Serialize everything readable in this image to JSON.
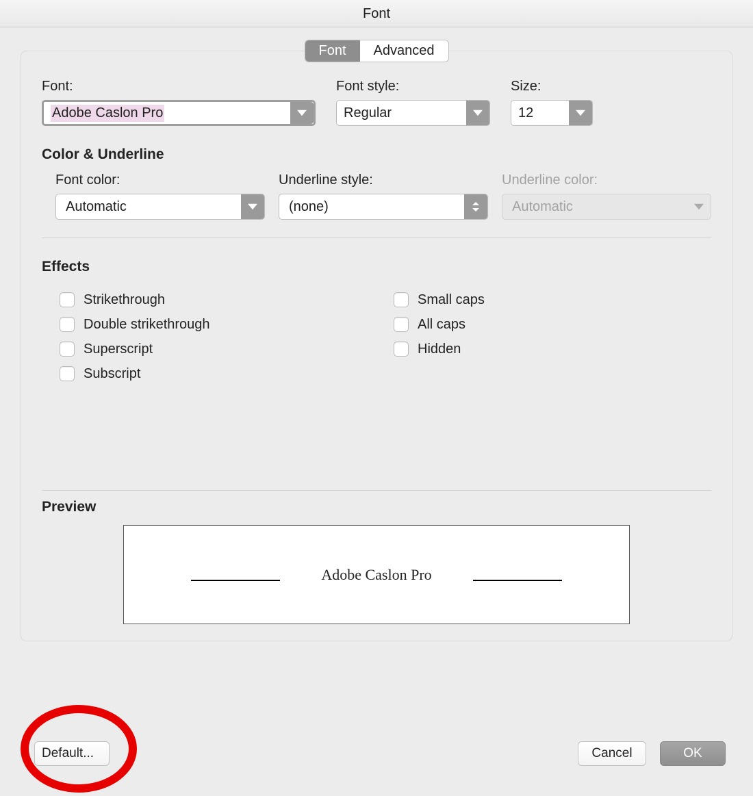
{
  "window": {
    "title": "Font"
  },
  "tabs": {
    "font": "Font",
    "advanced": "Advanced"
  },
  "fields": {
    "font_label": "Font:",
    "font_value": "Adobe Caslon Pro",
    "style_label": "Font style:",
    "style_value": "Regular",
    "size_label": "Size:",
    "size_value": "12"
  },
  "color_section": {
    "title": "Color & Underline",
    "font_color_label": "Font color:",
    "font_color_value": "Automatic",
    "underline_style_label": "Underline style:",
    "underline_style_value": "(none)",
    "underline_color_label": "Underline color:",
    "underline_color_value": "Automatic"
  },
  "effects": {
    "title": "Effects",
    "strikethrough": "Strikethrough",
    "double_strikethrough": "Double strikethrough",
    "superscript": "Superscript",
    "subscript": "Subscript",
    "small_caps": "Small caps",
    "all_caps": "All caps",
    "hidden": "Hidden"
  },
  "preview": {
    "title": "Preview",
    "sample": "Adobe Caslon Pro"
  },
  "buttons": {
    "default": "Default...",
    "cancel": "Cancel",
    "ok": "OK"
  }
}
